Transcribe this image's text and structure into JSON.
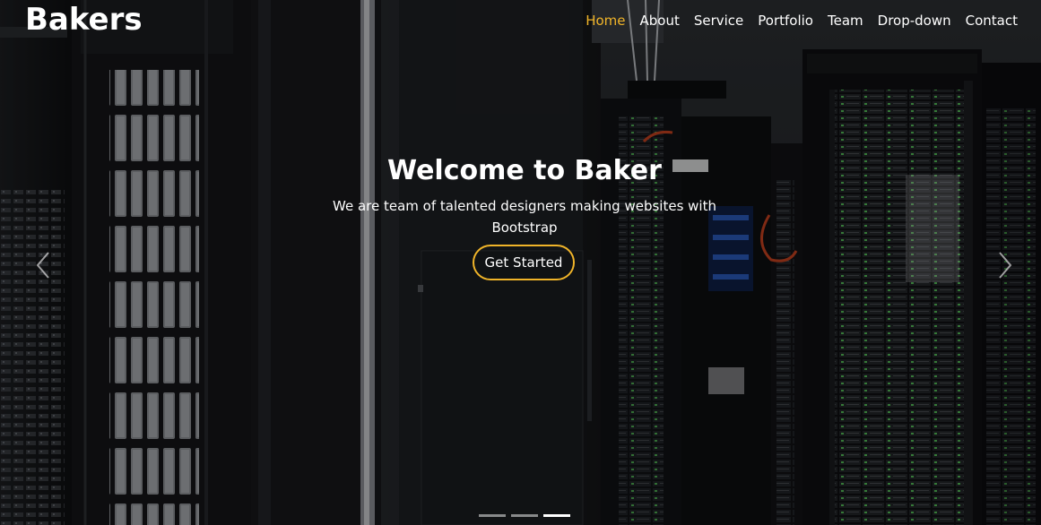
{
  "brand": "Bakers",
  "nav": {
    "items": [
      "Home",
      "About",
      "Service",
      "Portfolio",
      "Team",
      "Drop-down",
      "Contact"
    ],
    "active_index": 0,
    "active_color": "#f0b429"
  },
  "hero": {
    "title": "Welcome to Baker",
    "subtitle": "We are team of talented designers making websites with Bootstrap",
    "cta_label": "Get Started",
    "accent_color": "#f0b429"
  },
  "carousel": {
    "prev_icon": "chevron-left-icon",
    "next_icon": "chevron-right-icon",
    "slide_count": 3,
    "active_slide": 3
  }
}
